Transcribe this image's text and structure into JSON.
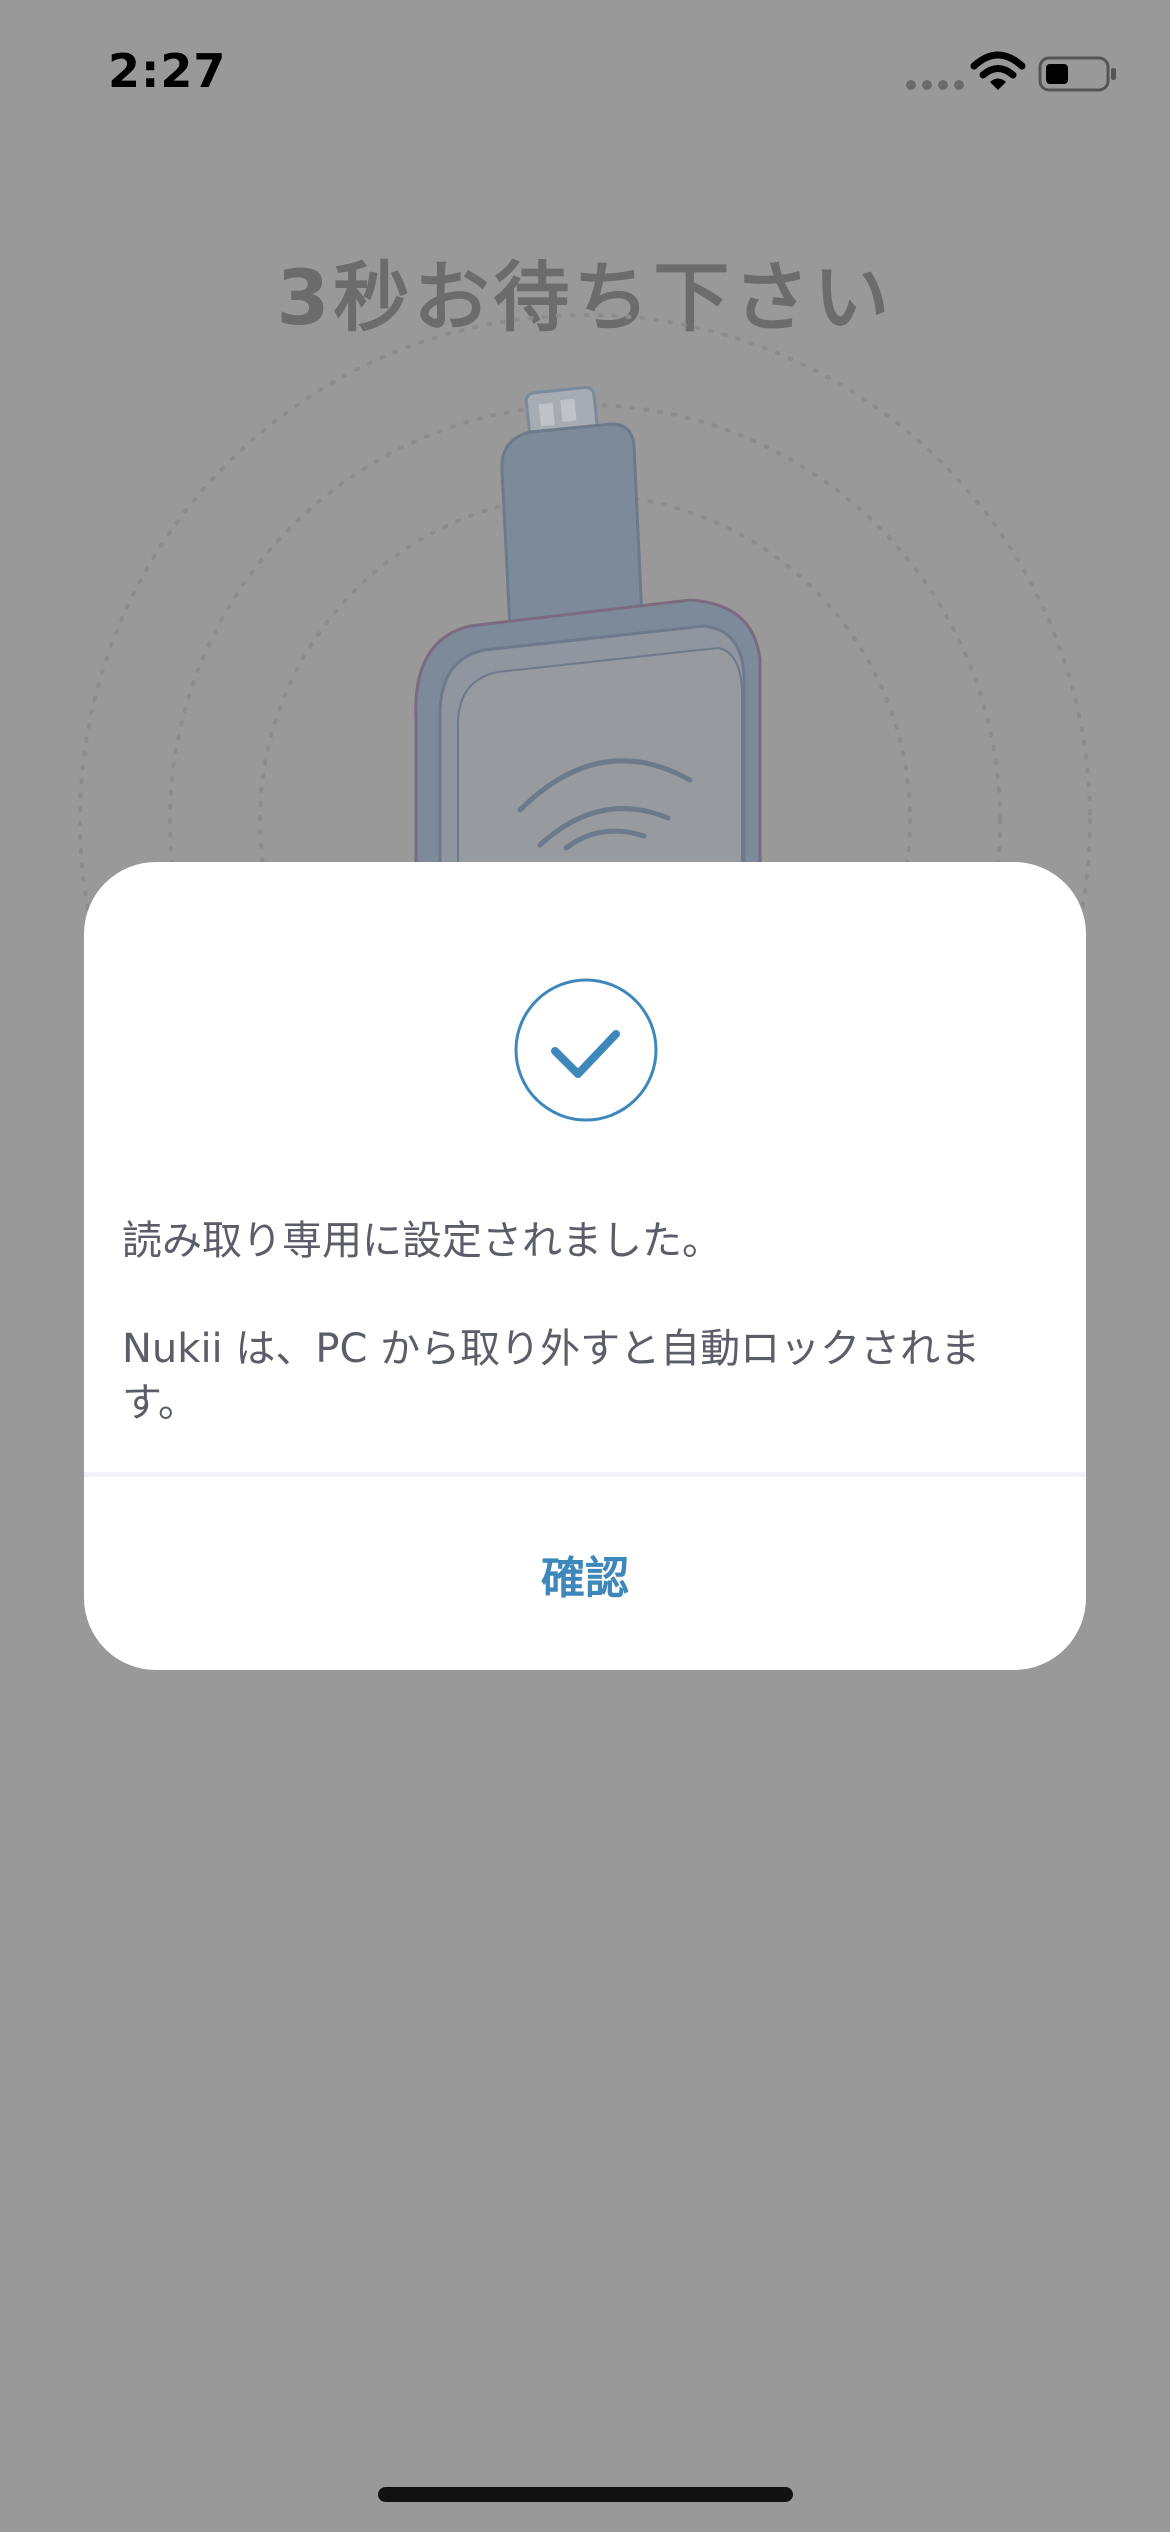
{
  "status_bar": {
    "time": "2:27",
    "battery_level": 0.35
  },
  "background": {
    "title": "3秒お待ち下さい"
  },
  "dialog": {
    "icon": "check-circle-icon",
    "message_line1": "読み取り専用に設定されました。",
    "message_line2": "Nukii は、PC から取り外すと自動ロックされます。",
    "confirm_label": "確認"
  },
  "colors": {
    "accent": "#3d87bb",
    "overlay": "#999999",
    "text": "#5b5e68"
  }
}
